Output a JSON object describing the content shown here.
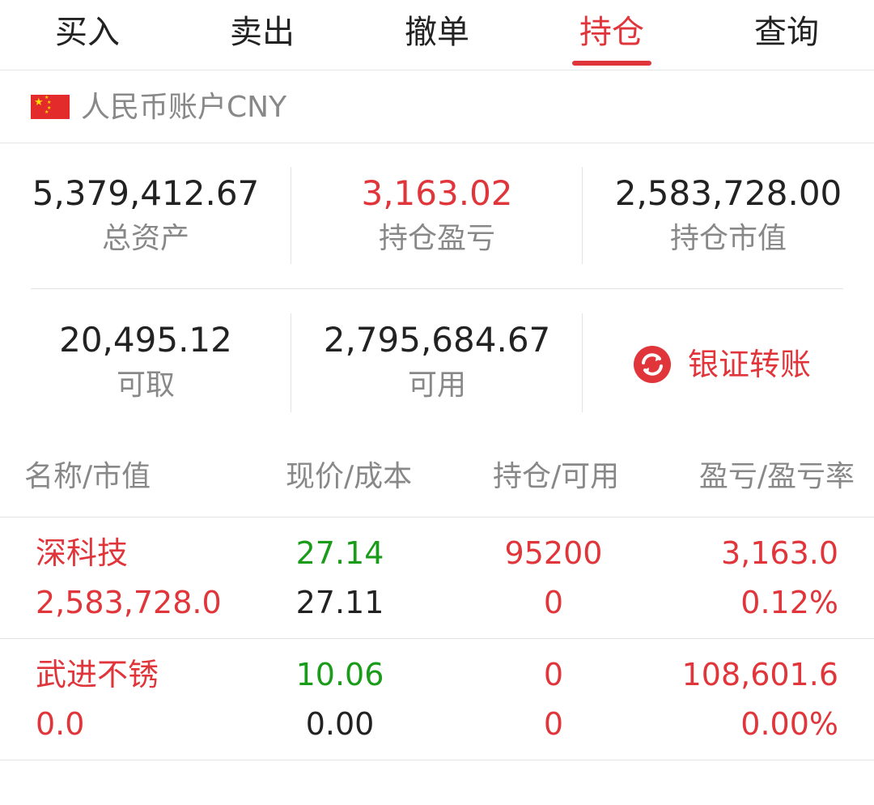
{
  "tabs": [
    {
      "label": "买入"
    },
    {
      "label": "卖出"
    },
    {
      "label": "撤单"
    },
    {
      "label": "持仓"
    },
    {
      "label": "查询"
    }
  ],
  "active_tab": "持仓",
  "account": {
    "flag": "china-flag-icon",
    "label": "人民币账户CNY"
  },
  "summary": {
    "total_assets": {
      "value": "5,379,412.67",
      "label": "总资产"
    },
    "position_pnl": {
      "value": "3,163.02",
      "label": "持仓盈亏"
    },
    "position_market_value": {
      "value": "2,583,728.00",
      "label": "持仓市值"
    },
    "withdrawable": {
      "value": "20,495.12",
      "label": "可取"
    },
    "available": {
      "value": "2,795,684.67",
      "label": "可用"
    },
    "transfer": {
      "label": "银证转账",
      "icon": "transfer-icon"
    }
  },
  "table": {
    "headers": [
      "名称/市值",
      "现价/成本",
      "持仓/可用",
      "盈亏/盈亏率"
    ],
    "rows": [
      {
        "name": "深科技",
        "market_value": "2,583,728.0",
        "price": "27.14",
        "cost": "27.11",
        "position": "95200",
        "available": "0",
        "pnl": "3,163.0",
        "pnl_rate": "0.12%"
      },
      {
        "name": "武进不锈",
        "market_value": "0.0",
        "price": "10.06",
        "cost": "0.00",
        "position": "0",
        "available": "0",
        "pnl": "108,601.6",
        "pnl_rate": "0.00%"
      }
    ]
  },
  "colors": {
    "accent_red": "#e0363b",
    "price_green": "#1a9b1a",
    "muted_gray": "#888888"
  }
}
